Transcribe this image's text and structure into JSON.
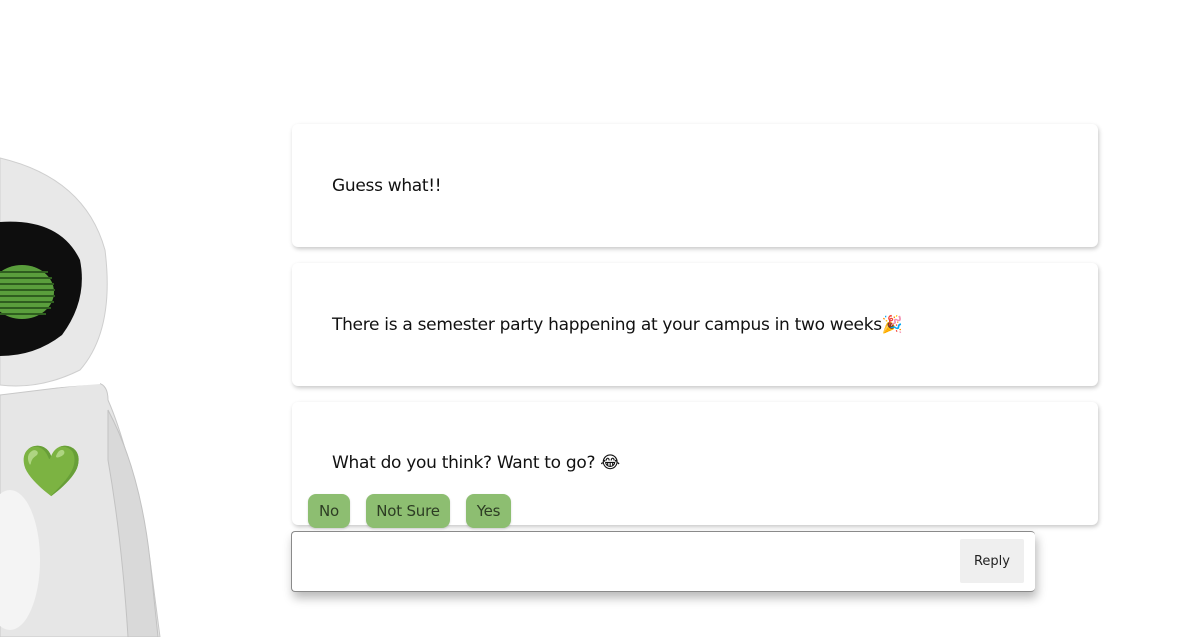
{
  "messages": [
    {
      "text": "Guess what!!"
    },
    {
      "text": "There is a semester party happening at your campus in two weeks🎉"
    },
    {
      "text": "What do you think? Want to go? 😂"
    }
  ],
  "quick_replies": [
    {
      "label": "No"
    },
    {
      "label": "Not Sure"
    },
    {
      "label": "Yes"
    }
  ],
  "reply": {
    "input_value": "",
    "button_label": "Reply"
  },
  "robot": {
    "heart_icon": "💚",
    "eye_color": "#5a9e3c",
    "button_color": "#8dbe71"
  }
}
